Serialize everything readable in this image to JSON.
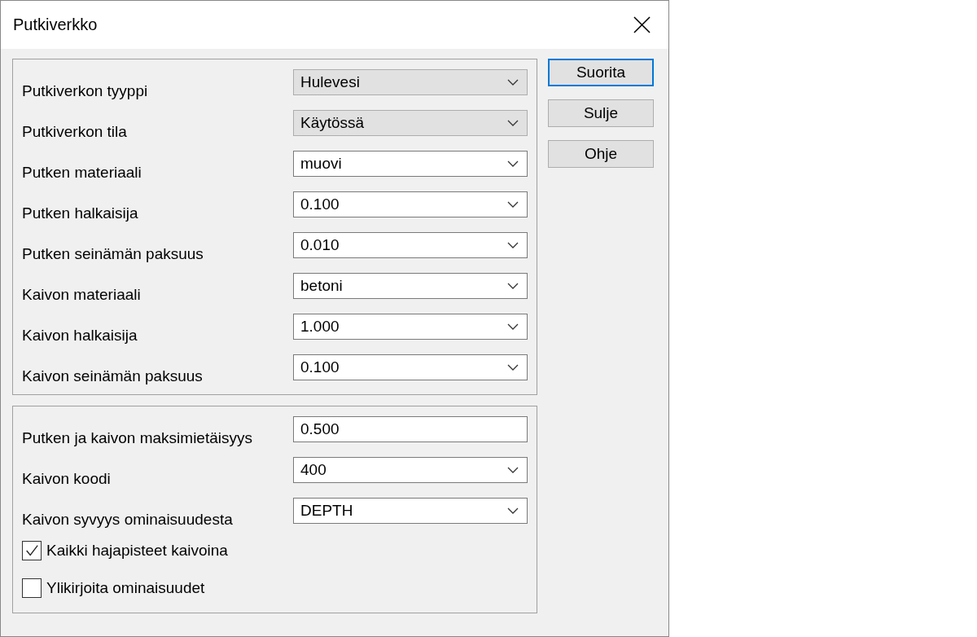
{
  "window": {
    "title": "Putkiverkko"
  },
  "groups": [
    {
      "rows": [
        {
          "label": "Putkiverkon tyyppi",
          "kind": "list",
          "value": "Hulevesi"
        },
        {
          "label": "Putkiverkon tila",
          "kind": "list",
          "value": "Käytössä"
        },
        {
          "label": "Putken materiaali",
          "kind": "combo",
          "value": "muovi"
        },
        {
          "label": "Putken halkaisija",
          "kind": "combo",
          "value": "0.100"
        },
        {
          "label": "Putken seinämän paksuus",
          "kind": "combo",
          "value": "0.010"
        },
        {
          "label": "Kaivon materiaali",
          "kind": "combo",
          "value": "betoni"
        },
        {
          "label": "Kaivon halkaisija",
          "kind": "combo",
          "value": "1.000"
        },
        {
          "label": "Kaivon seinämän paksuus",
          "kind": "combo",
          "value": "0.100"
        }
      ]
    },
    {
      "rows": [
        {
          "label": "Putken ja kaivon maksimietäisyys",
          "kind": "text",
          "value": "0.500"
        },
        {
          "label": "Kaivon koodi",
          "kind": "combo",
          "value": "400"
        },
        {
          "label": "Kaivon syvyys ominaisuudesta",
          "kind": "combo",
          "value": "DEPTH"
        },
        {
          "label": "Kaikki hajapisteet kaivoina",
          "kind": "checkbox",
          "checked": true
        },
        {
          "label": "Ylikirjoita ominaisuudet",
          "kind": "checkbox",
          "checked": false
        }
      ]
    }
  ],
  "buttons": [
    {
      "label": "Suorita",
      "default": true
    },
    {
      "label": "Sulje",
      "default": false
    },
    {
      "label": "Ohje",
      "default": false
    }
  ]
}
